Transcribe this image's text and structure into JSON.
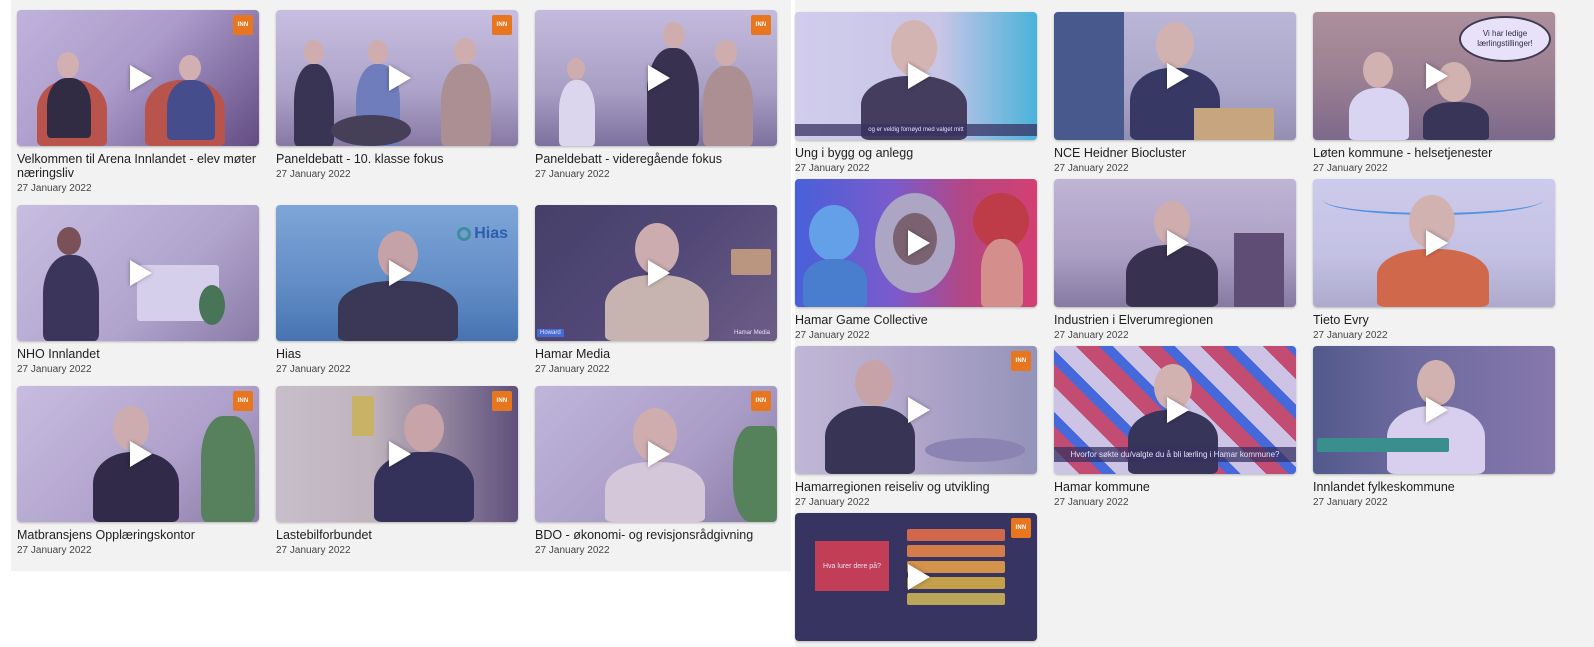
{
  "badge_text": "INN",
  "colors": {
    "accent_badge": "#e8761f",
    "panel_bg": "#f2f2f2",
    "text": "#1e1e1e"
  },
  "icons": {
    "play": "play-icon",
    "logo_badge": "inn-logo-icon"
  },
  "left_videos": [
    {
      "title": "Velkommen til Arena Innlandet - elev møter næringsliv",
      "date": "27 January 2022"
    },
    {
      "title": "Paneldebatt - 10. klasse fokus",
      "date": "27 January 2022"
    },
    {
      "title": "Paneldebatt - videregående fokus",
      "date": "27 January 2022"
    },
    {
      "title": "NHO Innlandet",
      "date": "27 January 2022"
    },
    {
      "title": "Hias",
      "date": "27 January 2022"
    },
    {
      "title": "Hamar Media",
      "date": "27 January 2022"
    },
    {
      "title": "Matbransjens Opplæringskontor",
      "date": "27 January 2022"
    },
    {
      "title": "Lastebilforbundet",
      "date": "27 January 2022"
    },
    {
      "title": "BDO - økonomi- og revisjonsrådgivning",
      "date": "27 January 2022"
    }
  ],
  "right_videos": [
    {
      "title": "Ung i bygg og anlegg",
      "date": "27 January 2022"
    },
    {
      "title": "NCE Heidner Biocluster",
      "date": "27 January 2022"
    },
    {
      "title": "Løten kommune - helsetjenester",
      "date": "27 January 2022"
    },
    {
      "title": "Hamar Game Collective",
      "date": "27 January 2022"
    },
    {
      "title": "Industrien i Elverumregionen",
      "date": "27 January 2022"
    },
    {
      "title": "Tieto Evry",
      "date": "27 January 2022"
    },
    {
      "title": "Hamarregionen reiseliv og utvikling",
      "date": "27 January 2022"
    },
    {
      "title": "Hamar kommune",
      "date": "27 January 2022"
    },
    {
      "title": "Innlandet fylkeskommune",
      "date": "27 January 2022"
    },
    {
      "title": "",
      "date": ""
    }
  ],
  "thumb_text": {
    "speech_bubble": "Vi har ledige lærlingstillinger!",
    "hias_logo": "Hias",
    "hamar_media_tag": "Hamar Media",
    "hamar_kommune_caption": "Hvorfor søkte du/valgte du å bli lærling i Hamar kommune?",
    "quiz_question": "Hva lurer dere på?"
  }
}
